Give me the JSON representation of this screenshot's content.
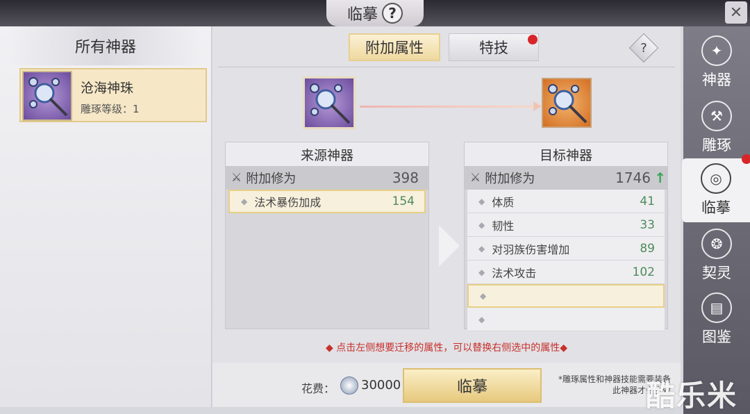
{
  "header": {
    "title": "临摹",
    "help": "?"
  },
  "left_panel": {
    "title": "所有神器",
    "items": [
      {
        "name": "沧海神珠",
        "level_text": "雕琢等级：1"
      }
    ]
  },
  "tabs": [
    {
      "label": "附加属性",
      "active": true
    },
    {
      "label": "特技",
      "active": false,
      "has_red_dot": true
    }
  ],
  "help_label": "?",
  "source": {
    "title": "来源神器",
    "head": {
      "label": "附加修为",
      "value": "398"
    },
    "attrs": [
      {
        "label": "法术暴伤加成",
        "value": "154",
        "selected": true
      }
    ]
  },
  "target": {
    "title": "目标神器",
    "head": {
      "label": "附加修为",
      "value": "1746"
    },
    "attrs": [
      {
        "label": "体质",
        "value": "41"
      },
      {
        "label": "韧性",
        "value": "33"
      },
      {
        "label": "对羽族伤害增加",
        "value": "89"
      },
      {
        "label": "法术攻击",
        "value": "102"
      },
      {
        "label": "",
        "value": ""
      },
      {
        "label": "",
        "value": ""
      }
    ]
  },
  "hint_text": "◆ 点击左侧想要迁移的属性，可以替换右侧选中的属性◆",
  "cost": {
    "label": "花费：",
    "amount": "30000"
  },
  "action_button": "临摹",
  "note": "*雕琢属性和神器技能需要装备此神器才会生效",
  "nav": [
    {
      "label": "神器",
      "active": false
    },
    {
      "label": "雕琢",
      "active": false
    },
    {
      "label": "临摹",
      "active": true
    },
    {
      "label": "契灵",
      "active": false
    },
    {
      "label": "图鉴",
      "active": false
    }
  ],
  "watermark": "酷乐米",
  "colors": {
    "accent_gold": "#e6cf90",
    "value_green": "#4e8a5a",
    "hint_red": "#c8302a",
    "red_dot": "#d8252a"
  }
}
